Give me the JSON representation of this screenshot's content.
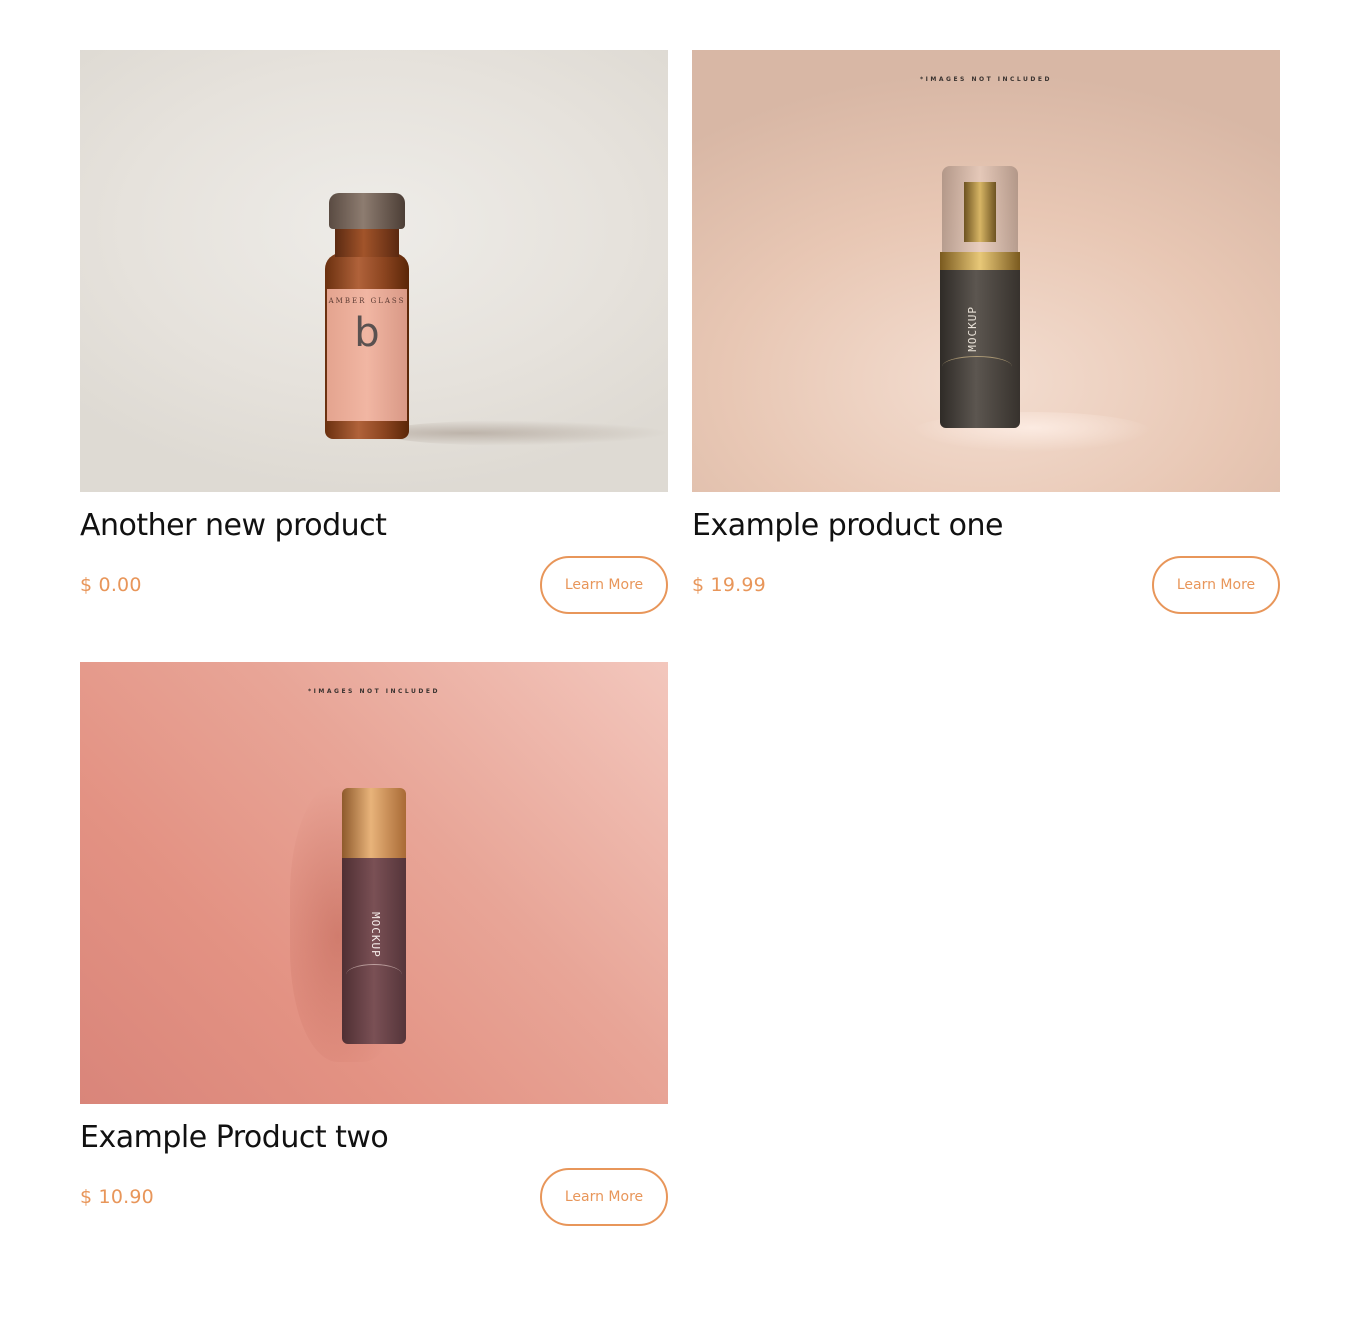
{
  "products": [
    {
      "title": "Another new product",
      "price": "$ 0.00",
      "button_label": "Learn More",
      "image": {
        "top_caption": "",
        "label_brand": "AMBER GLASS",
        "label_mark": "b"
      }
    },
    {
      "title": "Example product one",
      "price": "$ 19.99",
      "button_label": "Learn More",
      "image": {
        "top_caption": "*IMAGES NOT INCLUDED",
        "label_word": "MOCKUP"
      }
    },
    {
      "title": "Example Product two",
      "price": "$ 10.90",
      "button_label": "Learn More",
      "image": {
        "top_caption": "*IMAGES NOT INCLUDED",
        "label_word": "MOCKUP"
      }
    }
  ],
  "colors": {
    "accent": "#e8965a",
    "title": "#111111",
    "background": "#ffffff"
  }
}
